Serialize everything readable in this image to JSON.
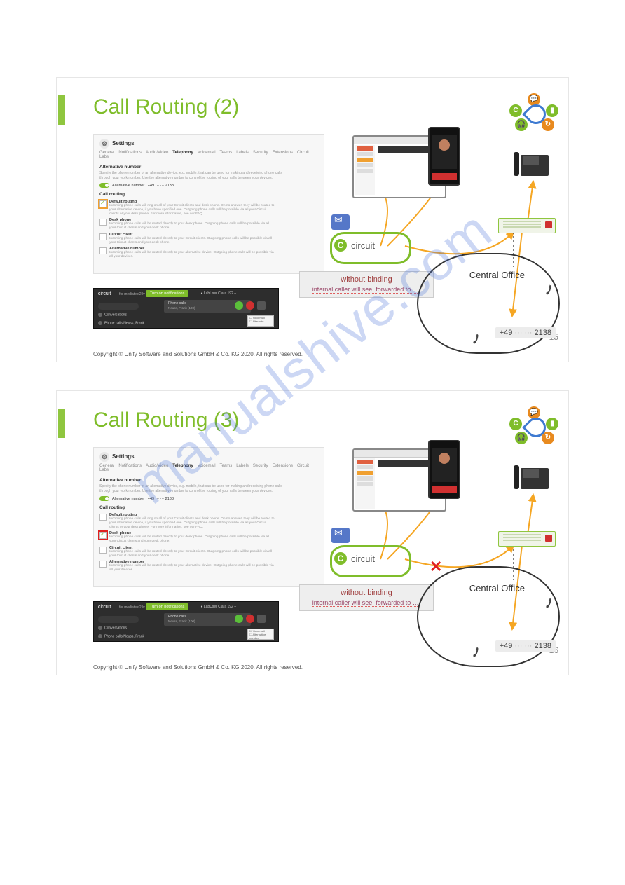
{
  "watermark": "manualshive.com",
  "slides": [
    {
      "title": "Call Routing (2)",
      "page_num": "15",
      "copyright": "Copyright © Unify Software and Solutions GmbH & Co. KG 2020. All rights reserved.",
      "settings": {
        "header": "Settings",
        "tabs": [
          "General",
          "Notifications",
          "Audio/Video",
          "Telephony",
          "Voicemail",
          "Teams",
          "Labels",
          "Security",
          "Extensions",
          "Circuit Labs"
        ],
        "active_tab": "Telephony",
        "alt_section_title": "Alternative number",
        "alt_desc": "Specify the phone number of an alternative device, e.g. mobile, that can be used for making and receiving phone calls through your work number. Use the alternative number to control the routing of your calls between your devices.",
        "alt_label": "Alternative number",
        "alt_value": "+49 ··· ··· 2138",
        "routing_title": "Call routing",
        "options": [
          {
            "label": "Default routing",
            "desc": "Incoming phone calls will ring on all of your Circuit clients and desk phone. On no answer, they will be routed to your alternative device, if you have specified one. Outgoing phone calls will be possible via all your Circuit clients or your desk phone. For more information, see our FAQ.",
            "highlight": "orange",
            "checked": true
          },
          {
            "label": "Desk phone",
            "desc": "Incoming phone calls will be routed directly to your desk phone. Outgoing phone calls will be possible via all your Circuit clients and your desk phone."
          },
          {
            "label": "Circuit client",
            "desc": "Incoming phone calls will be routed directly to your Circuit clients. Outgoing phone calls will be possible via all your Circuit clients and your desk phone."
          },
          {
            "label": "Alternative number",
            "desc": "Incoming phone calls will be routed directly to your alternative device. Outgoing phone calls will be possible via all your devices."
          }
        ]
      },
      "dark": {
        "logo": "circuit",
        "sub": "for mediatest2 lv",
        "pill": "Turn on notifications",
        "call_title": "Phone calls",
        "call_sub": "Neuss, Frank (100)",
        "status": "LabUser Clara 192 –",
        "rows": [
          "Conversations",
          "Phone calls   Neuss, Frank"
        ],
        "panel": [
          "☐ Voicemail",
          "☐ Alternate"
        ]
      },
      "diagram": {
        "circuit_label": "circuit",
        "note_title": "without binding",
        "note_sub": "internal caller will see: forwarded to ….",
        "co_label": "Central Office",
        "number": "+49 ··· ··· 2138",
        "show_x": false
      }
    },
    {
      "title": "Call Routing (3)",
      "page_num": "16",
      "copyright": "Copyright © Unify Software and Solutions GmbH & Co. KG 2020. All rights reserved.",
      "settings": {
        "header": "Settings",
        "tabs": [
          "General",
          "Notifications",
          "Audio/Video",
          "Telephony",
          "Voicemail",
          "Teams",
          "Labels",
          "Security",
          "Extensions",
          "Circuit Labs"
        ],
        "active_tab": "Telephony",
        "alt_section_title": "Alternative number",
        "alt_desc": "Specify the phone number of an alternative device, e.g. mobile, that can be used for making and receiving phone calls through your work number. Use the alternative number to control the routing of your calls between your devices.",
        "alt_label": "Alternative number",
        "alt_value": "+49 ··· ··· 2138",
        "routing_title": "Call routing",
        "options": [
          {
            "label": "Default routing",
            "desc": "Incoming phone calls will ring on all of your Circuit clients and desk phone. On no answer, they will be routed to your alternative device, if you have specified one. Outgoing phone calls will be possible via all your Circuit clients or your desk phone. For more information, see our FAQ."
          },
          {
            "label": "Desk phone",
            "desc": "Incoming phone calls will be routed directly to your desk phone. Outgoing phone calls will be possible via all your Circuit clients and your desk phone.",
            "highlight": "red",
            "checked": true
          },
          {
            "label": "Circuit client",
            "desc": "Incoming phone calls will be routed directly to your Circuit clients. Outgoing phone calls will be possible via all your Circuit clients and your desk phone."
          },
          {
            "label": "Alternative number",
            "desc": "Incoming phone calls will be routed directly to your alternative device. Outgoing phone calls will be possible via all your devices."
          }
        ]
      },
      "dark": {
        "logo": "circuit",
        "sub": "for mediatest2 lv",
        "pill": "Turn on notifications",
        "call_title": "Phone calls",
        "call_sub": "Neuss, Frank (100)",
        "status": "LabUser Clara 192 –",
        "rows": [
          "Conversations",
          "Phone calls   Neuss, Frank"
        ],
        "panel": [
          "☐ Voicemail",
          "☐ Alternative number"
        ]
      },
      "diagram": {
        "circuit_label": "circuit",
        "note_title": "without binding",
        "note_sub": "internal caller will see: forwarded to ….",
        "co_label": "Central Office",
        "number": "+49 ··· ··· 2138",
        "show_x": true
      }
    }
  ]
}
